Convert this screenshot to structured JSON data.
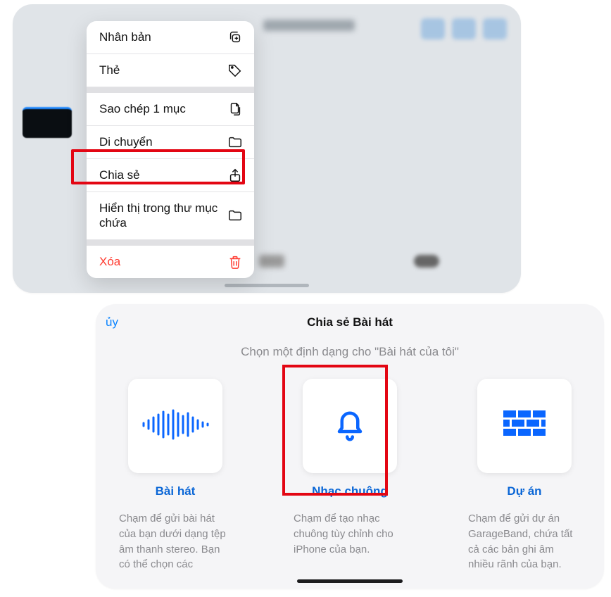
{
  "context_menu": {
    "items": [
      {
        "label": "Nhân bản",
        "icon": "duplicate"
      },
      {
        "label": "Thẻ",
        "icon": "tag"
      }
    ],
    "items2": [
      {
        "label": "Sao chép 1 mục",
        "icon": "copy"
      },
      {
        "label": "Di chuyển",
        "icon": "folder"
      },
      {
        "label": "Chia sẻ",
        "icon": "share"
      },
      {
        "label": "Hiển thị trong thư mục chứa",
        "icon": "folder"
      }
    ],
    "items3": [
      {
        "label": "Xóa",
        "icon": "trash",
        "danger": true
      }
    ]
  },
  "share_sheet": {
    "cancel": "ủy",
    "title": "Chia sẻ Bài hát",
    "subtitle": "Chọn một định dạng cho \"Bài hát của tôi\"",
    "options": [
      {
        "title": "Bài hát",
        "icon": "waveform",
        "desc": "Chạm để gửi bài hát của bạn dưới dạng tệp âm thanh stereo. Bạn có thể chọn các"
      },
      {
        "title": "Nhạc chuông",
        "icon": "bell",
        "desc": "Chạm để tạo nhạc chuông tùy chỉnh cho iPhone của bạn."
      },
      {
        "title": "Dự án",
        "icon": "bricks",
        "desc": "Chạm để gửi dự án GarageBand, chứa tất cả các bản ghi âm nhiều rãnh của bạn."
      }
    ]
  }
}
